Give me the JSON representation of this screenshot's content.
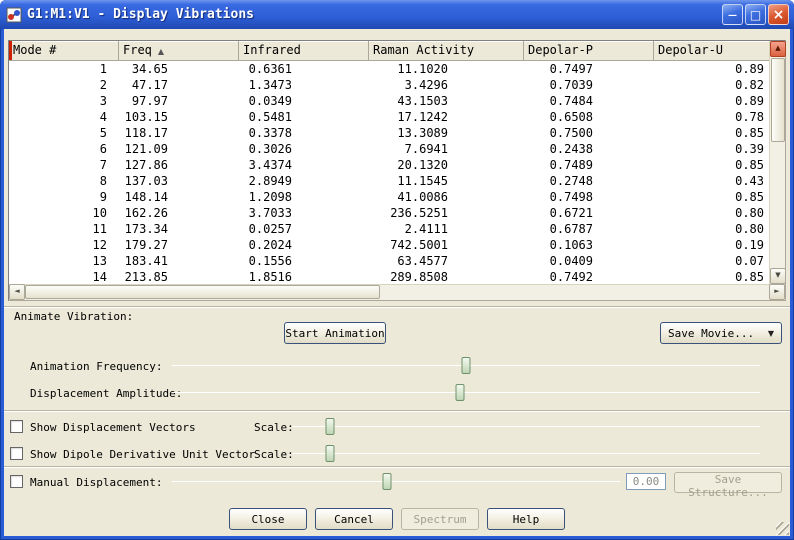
{
  "window": {
    "title": "G1:M1:V1 - Display Vibrations"
  },
  "icons": {
    "minimize": "—",
    "maximize": "□",
    "close": "×",
    "sort_ascending": "▲",
    "dropdown": "▼",
    "scroll_up": "▲",
    "scroll_down": "▼",
    "scroll_left": "◄",
    "scroll_right": "►"
  },
  "colors": {
    "frame_blue": "#2A5BD6",
    "dialog_background": "#ECE9D8",
    "table_background": "#FFFFFF",
    "close_button_red": "#DD5B33",
    "marker_red": "#CC2200",
    "slider_thumb_green": "#BED6B4"
  },
  "table": {
    "columns": [
      "Mode #",
      "Freq",
      "Infrared",
      "Raman Activity",
      "Depolar-P",
      "Depolar-U"
    ],
    "sort": {
      "column": "Freq",
      "direction": "ascending"
    },
    "rows": [
      [
        "1",
        "34.65",
        "0.6361",
        "11.1020",
        "0.7497",
        "0.89"
      ],
      [
        "2",
        "47.17",
        "1.3473",
        "3.4296",
        "0.7039",
        "0.82"
      ],
      [
        "3",
        "97.97",
        "0.0349",
        "43.1503",
        "0.7484",
        "0.89"
      ],
      [
        "4",
        "103.15",
        "0.5481",
        "17.1242",
        "0.6508",
        "0.78"
      ],
      [
        "5",
        "118.17",
        "0.3378",
        "13.3089",
        "0.7500",
        "0.85"
      ],
      [
        "6",
        "121.09",
        "0.3026",
        "7.6941",
        "0.2438",
        "0.39"
      ],
      [
        "7",
        "127.86",
        "3.4374",
        "20.1320",
        "0.7489",
        "0.85"
      ],
      [
        "8",
        "137.03",
        "2.8949",
        "11.1545",
        "0.2748",
        "0.43"
      ],
      [
        "9",
        "148.14",
        "1.2098",
        "41.0086",
        "0.7498",
        "0.85"
      ],
      [
        "10",
        "162.26",
        "3.7033",
        "236.5251",
        "0.6721",
        "0.80"
      ],
      [
        "11",
        "173.34",
        "0.0257",
        "2.4111",
        "0.6787",
        "0.80"
      ],
      [
        "12",
        "179.27",
        "0.2024",
        "742.5001",
        "0.1063",
        "0.19"
      ],
      [
        "13",
        "183.41",
        "0.1556",
        "63.4577",
        "0.0409",
        "0.07"
      ],
      [
        "14",
        "213.85",
        "1.8516",
        "289.8508",
        "0.7492",
        "0.85"
      ]
    ]
  },
  "animate": {
    "section_label": "Animate Vibration:",
    "start_button": "Start Animation",
    "save_movie_button": "Save Movie..."
  },
  "sliders": {
    "animation_frequency": {
      "label": "Animation Frequency:",
      "value_pct": 50
    },
    "displacement_amplitude": {
      "label": "Displacement Amplitude:",
      "value_pct": 49
    },
    "displacement_vectors_scale": {
      "label": "Scale:",
      "value_pct": 8.5
    },
    "dipole_derivative_scale": {
      "label": "Scale:",
      "value_pct": 8.5
    },
    "manual_displacement": {
      "value_pct": 48
    }
  },
  "checkboxes": {
    "show_displacement_vectors": {
      "label": "Show Displacement Vectors",
      "checked": false
    },
    "show_dipole_derivative": {
      "label": "Show Dipole Derivative Unit Vector",
      "checked": false
    },
    "manual_displacement": {
      "label": "Manual Displacement:",
      "checked": false
    }
  },
  "manual": {
    "value": "0.00",
    "save_structure_button": "Save Structure..."
  },
  "footer_buttons": {
    "close": "Close",
    "cancel": "Cancel",
    "spectrum": "Spectrum",
    "help": "Help"
  }
}
